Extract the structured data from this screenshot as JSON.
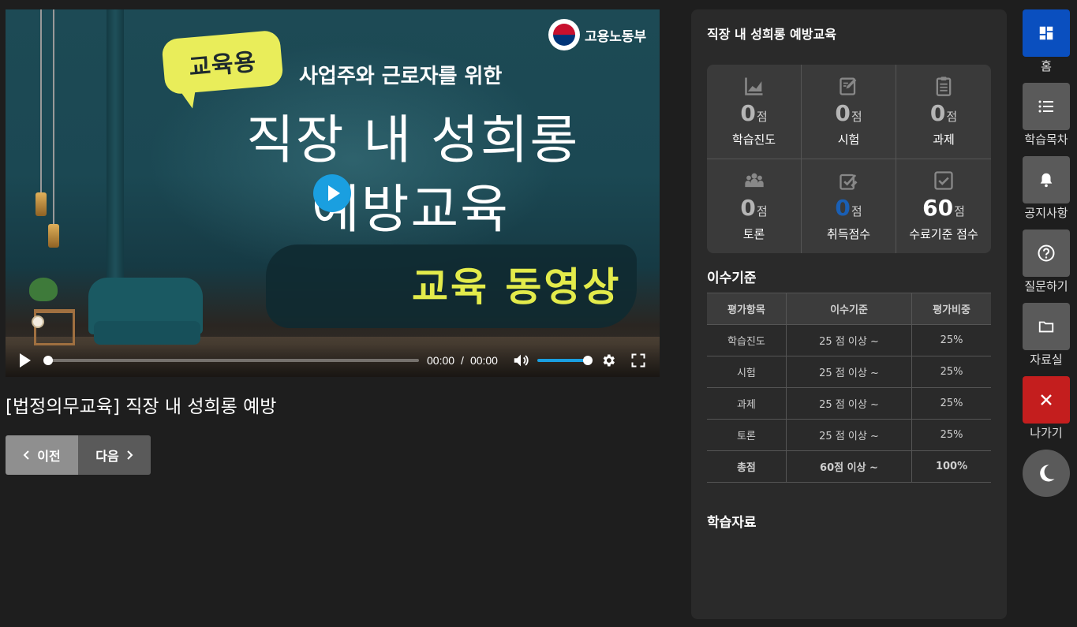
{
  "video": {
    "badge": "교육용",
    "ministry": "고용노동부",
    "subtitle": "사업주와 근로자를 위한",
    "title_line1": "직장 내 성희롱",
    "title_line2": "예방교육",
    "highlight": "교육 동영상",
    "time_current": "00:00",
    "time_separator": "/",
    "time_total": "00:00",
    "progress": 0,
    "volume": 1
  },
  "lecture": {
    "title": "[법정의무교육] 직장 내 성희롱 예방",
    "prev_label": "이전",
    "next_label": "다음"
  },
  "panel": {
    "title": "직장 내 성희롱 예방교육",
    "unit": "점",
    "scores": [
      {
        "icon": "chart-icon",
        "value": "0",
        "label": "학습진도",
        "color": "gray"
      },
      {
        "icon": "edit-icon",
        "value": "0",
        "label": "시험",
        "color": "gray"
      },
      {
        "icon": "clipboard-icon",
        "value": "0",
        "label": "과제",
        "color": "gray"
      },
      {
        "icon": "people-icon",
        "value": "0",
        "label": "토론",
        "color": "gray"
      },
      {
        "icon": "badge-check-icon",
        "value": "0",
        "label": "취득점수",
        "color": "#1a5fb4"
      },
      {
        "icon": "checkbox-icon",
        "value": "60",
        "label": "수료기준 점수",
        "color": "#ffffff"
      }
    ],
    "criteria_title": "이수기준",
    "criteria_headers": [
      "평가항목",
      "이수기준",
      "평가비중"
    ],
    "criteria_rows": [
      [
        "학습진도",
        "25 점 이상 ~",
        "25%"
      ],
      [
        "시험",
        "25 점 이상 ~",
        "25%"
      ],
      [
        "과제",
        "25 점 이상 ~",
        "25%"
      ],
      [
        "토론",
        "25 점 이상 ~",
        "25%"
      ],
      [
        "총점",
        "60점 이상 ~",
        "100%"
      ]
    ],
    "material_title": "학습자료"
  },
  "menu": [
    {
      "label": "홈",
      "icon": "dashboard-icon"
    },
    {
      "label": "학습목차",
      "icon": "list-icon"
    },
    {
      "label": "공지사항",
      "icon": "bell-icon"
    },
    {
      "label": "질문하기",
      "icon": "question-icon"
    },
    {
      "label": "자료실",
      "icon": "folder-icon"
    },
    {
      "label": "나가기",
      "icon": "close-icon"
    }
  ],
  "colors": {
    "accent": "#0a4fbf",
    "exit": "#c41e1e",
    "player_blue": "#1a9fe0",
    "earned_score": "#1a5fb4"
  }
}
